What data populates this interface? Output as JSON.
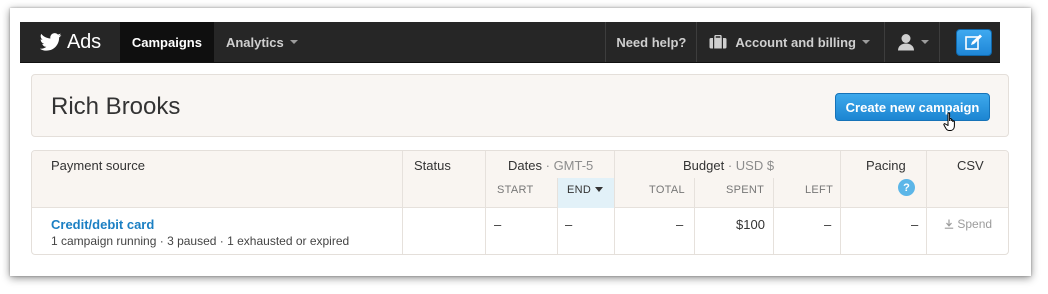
{
  "brand": {
    "name": "Ads"
  },
  "nav": {
    "campaigns": "Campaigns",
    "analytics": "Analytics",
    "help": "Need help?",
    "account": "Account and billing"
  },
  "header": {
    "title": "Rich Brooks",
    "create_button": "Create new campaign"
  },
  "table": {
    "headers": {
      "payment_source": "Payment source",
      "status": "Status",
      "dates": "Dates",
      "dates_tz": "GMT-5",
      "budget": "Budget",
      "budget_currency": "USD $",
      "pacing": "Pacing",
      "csv": "CSV",
      "sep": "·"
    },
    "subheaders": {
      "start": "START",
      "end": "END",
      "total": "TOTAL",
      "spent": "SPENT",
      "left": "LEFT",
      "pacing_help": "?"
    },
    "rows": [
      {
        "source": "Credit/debit card",
        "summary": "1 campaign running · 3 paused · 1 exhausted or expired",
        "status": "",
        "start": "–",
        "end": "–",
        "total": "–",
        "spent": "$100",
        "left": "–",
        "pacing": "–",
        "csv": "Spend"
      }
    ]
  },
  "colors": {
    "nav_bg": "#262626",
    "accent": "#1b7fc3",
    "button": "#2a93de"
  }
}
